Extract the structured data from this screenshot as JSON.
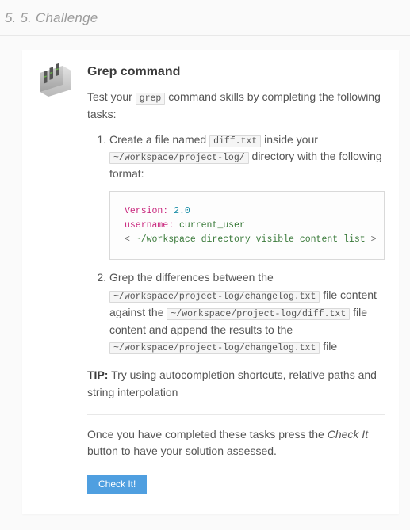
{
  "section_number": "5. 5.",
  "section_label": "Challenge",
  "title": "Grep command",
  "intro_a": "Test your ",
  "intro_cmd": "grep",
  "intro_b": " command skills by completing the following tasks:",
  "tasks": [
    {
      "t1": "Create a file named ",
      "c1": "diff.txt",
      "t2": " inside your ",
      "c2": "~/workspace/project-log/",
      "t3": " directory with the following format:"
    },
    {
      "t1": "Grep the differences between the ",
      "c1": "~/workspace/project-log/changelog.txt",
      "t2": " file content against the ",
      "c2": "~/workspace/project-log/diff.txt",
      "t3": " file content and append the results to the ",
      "c3": "~/workspace/project-log/changelog.txt",
      "t4": " file"
    }
  ],
  "code": {
    "k1": "Version:",
    "v1": "2.0",
    "k2": "username:",
    "v2": "current_user",
    "l3a": "< ",
    "l3b": "~/workspace directory visible content list",
    "l3c": " >"
  },
  "tip_label": "TIP:",
  "tip_body": " Try using autocompletion shortcuts, relative paths and string interpolation",
  "final_a": "Once you have completed these tasks press the ",
  "final_em": "Check It",
  "final_b": " button to have your solution assessed.",
  "button": "Check It!"
}
